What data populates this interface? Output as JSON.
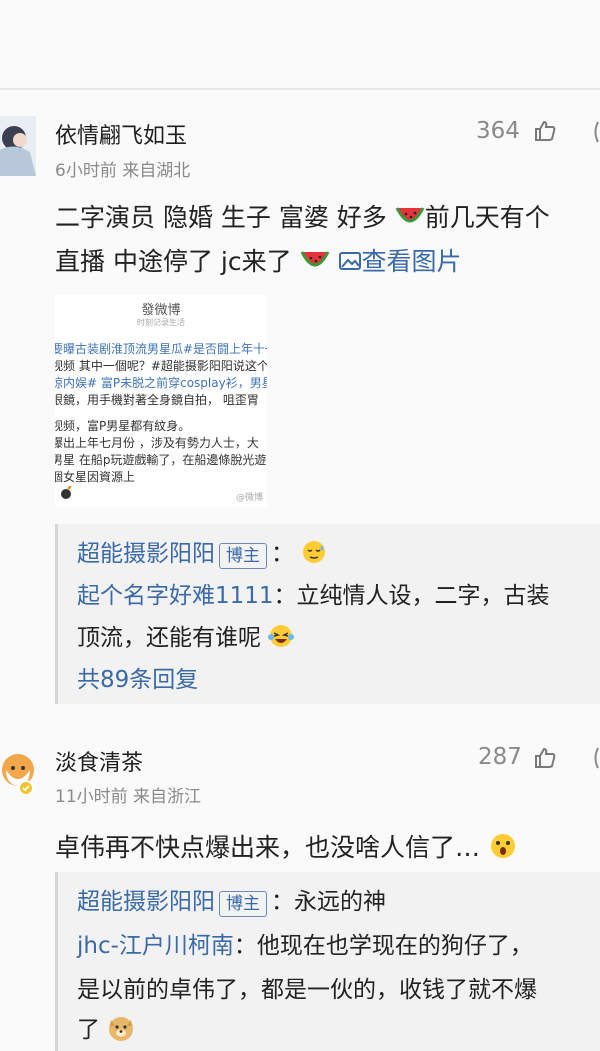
{
  "comments": [
    {
      "username": "依情翩飞如玉",
      "meta": "6小时前  来自湖北",
      "likes": "364",
      "body_line1": "二字演员 隐婚 生子 富婆 好多",
      "body_line1_tail": "前几天有个",
      "body_line2_a": "直播 中途停了 jc来了",
      "view_image": "查看图片",
      "image_card": {
        "header": "發微博",
        "subheader": "时刻记录生活",
        "lines": [
          "要曝古装剧淮顶流男星瓜#是否闘上年十一月",
          "视频 其中一個呢？#超能摄影阳阳说这个",
          "惊内娱# 富P未脱之前穿cosplay衫，男星事",
          "眼鏡，用手機對著全身鏡自拍，   咀歪胃",
          "视频，富P男星都有紋身。",
          "爆出上年七月份 ，涉及有勢力人士，大",
          "男星 在船p玩遊戲輸了，在船邊條脫光遊",
          "個女星因資源上"
        ],
        "watermark": "@微博"
      },
      "replies": [
        {
          "user": "超能摄影阳阳",
          "badge": "博主",
          "sep": "：",
          "text": ""
        },
        {
          "user": "起个名字好难1111",
          "sep": "：",
          "text": "立纯情人设，二字，古装",
          "text2": "顶流，还能有谁呢"
        }
      ],
      "more_replies": "共89条回复"
    },
    {
      "username": "淡食清茶",
      "meta": "11小时前  来自浙江",
      "likes": "287",
      "body_line1": "卓伟再不快点爆出来，也没啥人信了…",
      "replies": [
        {
          "user": "超能摄影阳阳",
          "badge": "博主",
          "sep": "：",
          "text": "永远的神"
        },
        {
          "user": "jhc-江户川柯南",
          "sep": "：",
          "text": "他现在也学现在的狗仔了，",
          "text2": "是以前的卓伟了，都是一伙的，收钱了就不爆",
          "text3": "了"
        }
      ]
    }
  ],
  "colors": {
    "link": "#3b6aa8",
    "meta": "#8a8a8a",
    "reply_bg": "#f2f2f2"
  }
}
